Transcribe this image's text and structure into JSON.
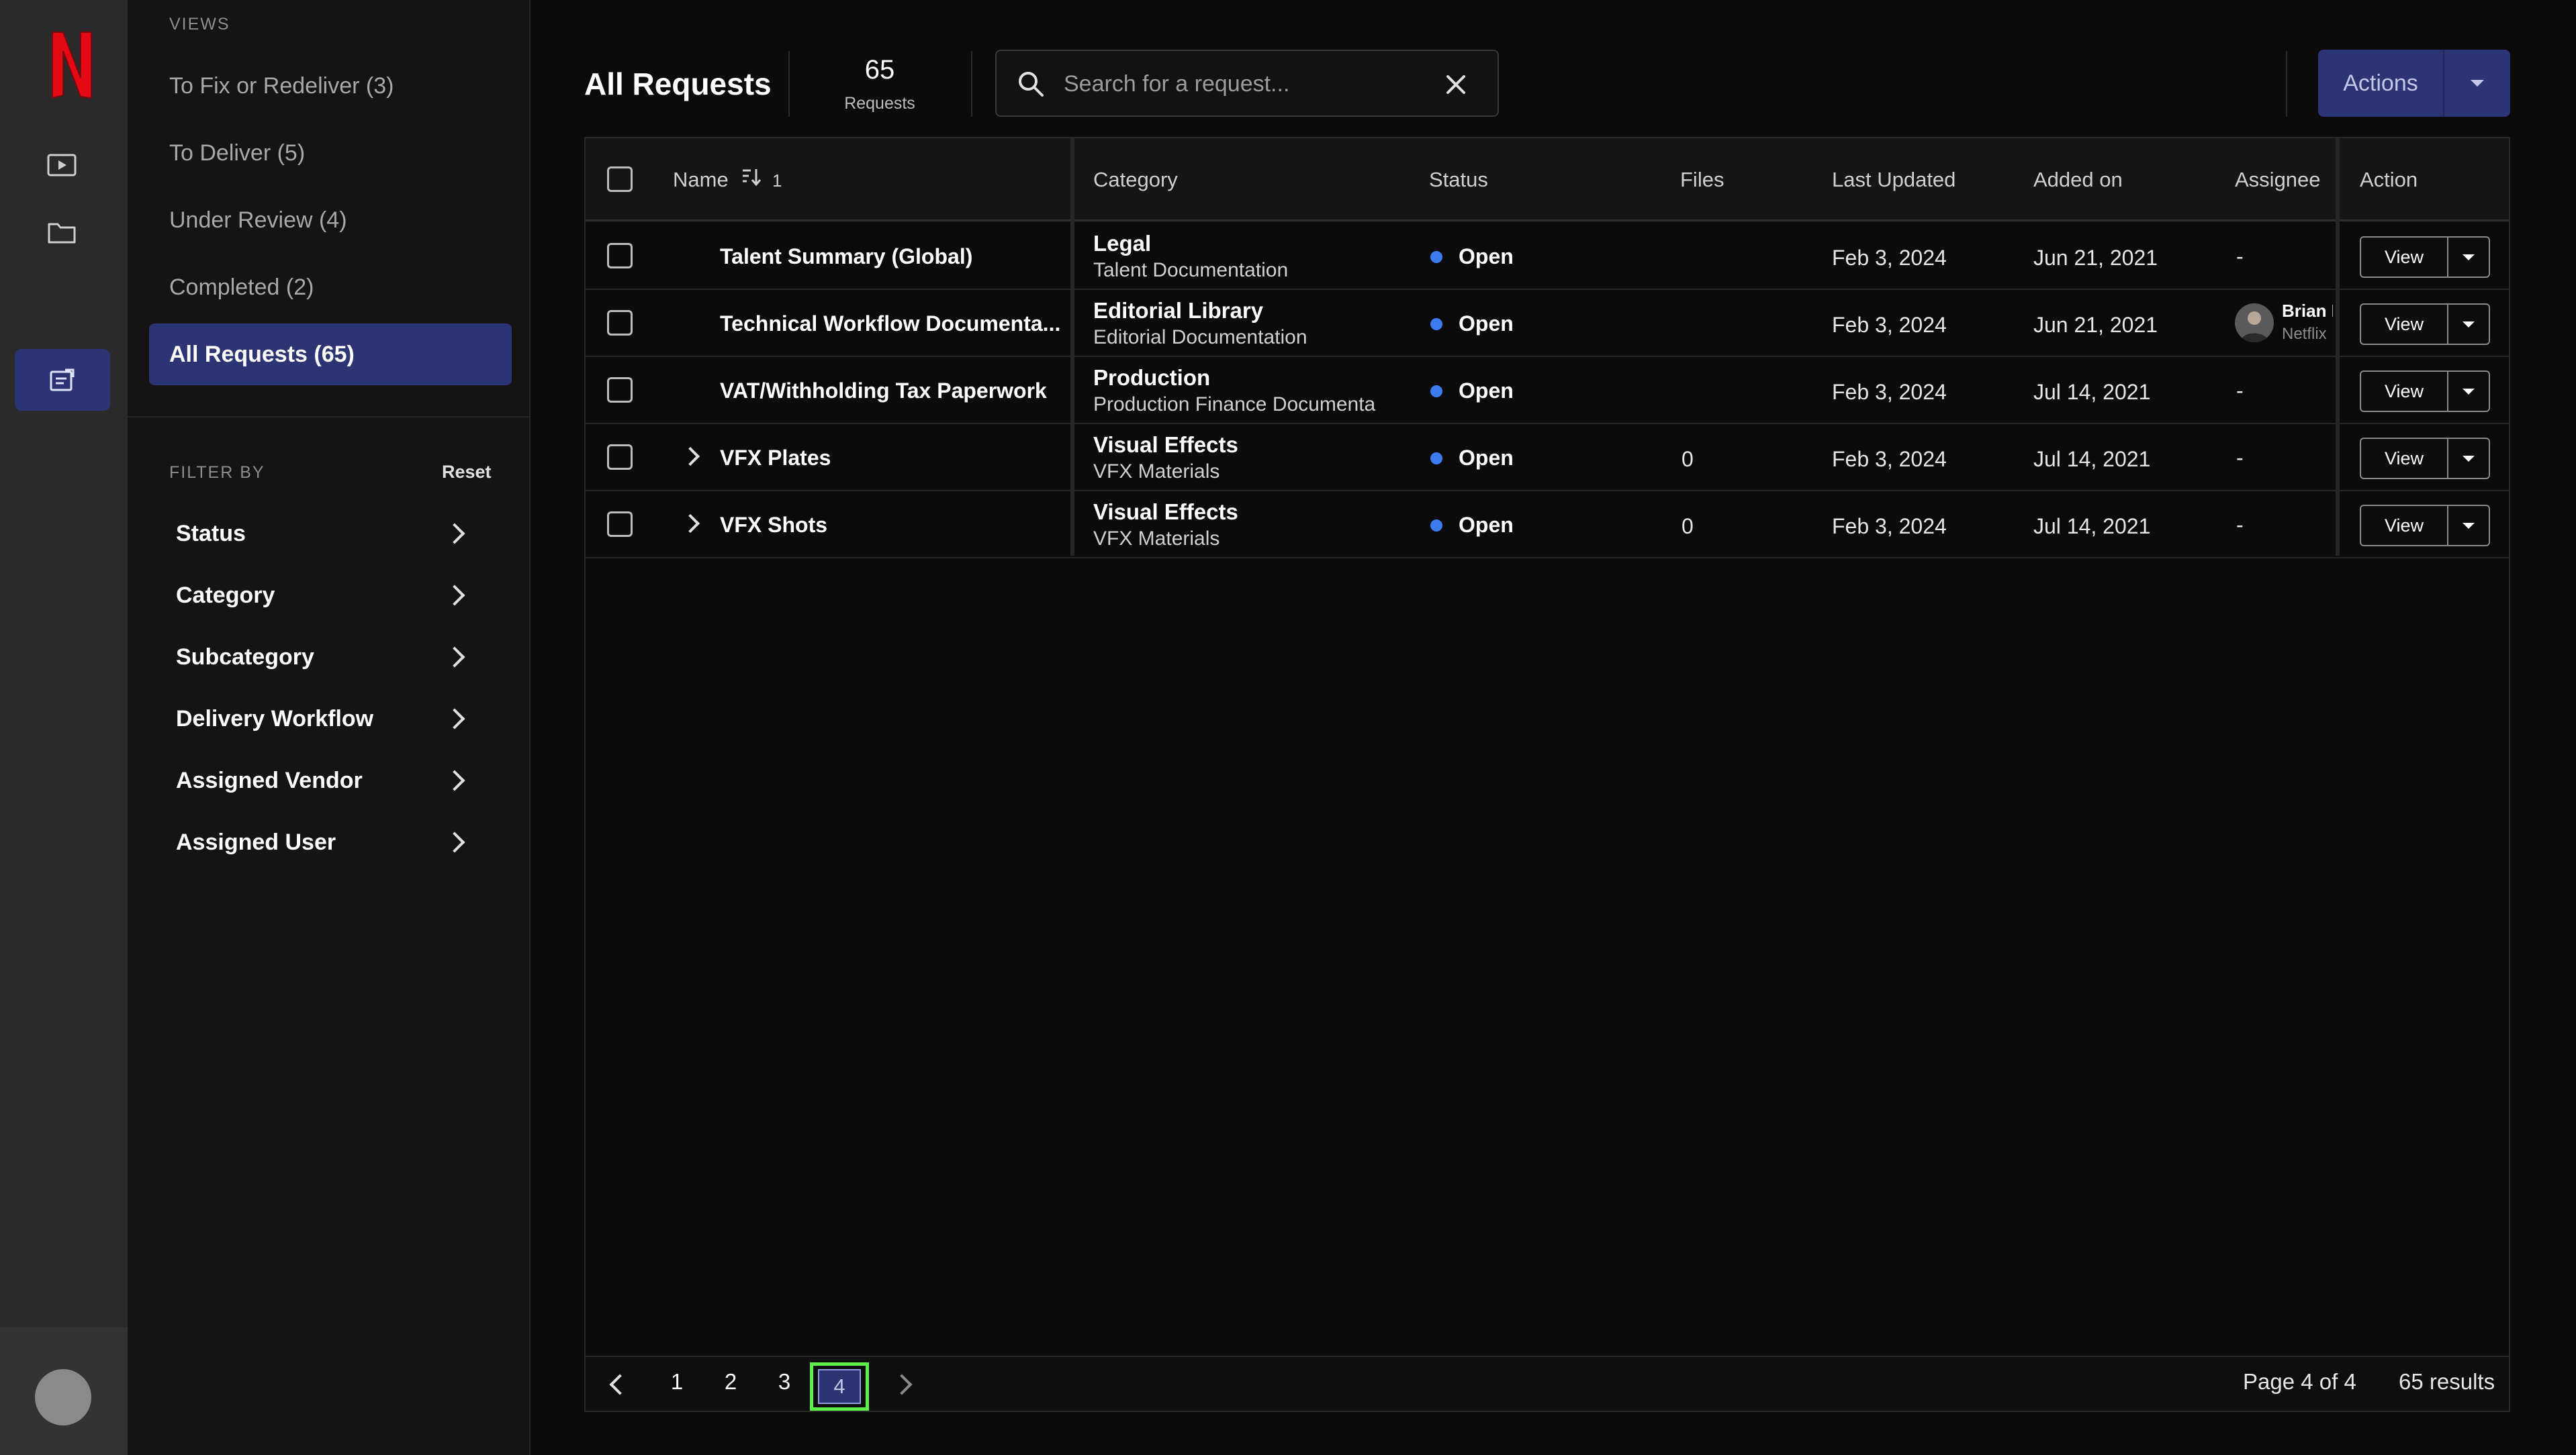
{
  "sidebar": {
    "views_label": "VIEWS",
    "views": [
      {
        "label": "To Fix or Redeliver (3)"
      },
      {
        "label": "To Deliver (5)"
      },
      {
        "label": "Under Review (4)"
      },
      {
        "label": "Completed (2)"
      },
      {
        "label": "All Requests (65)"
      }
    ],
    "filter_label": "FILTER BY",
    "reset_label": "Reset",
    "filters": [
      {
        "label": "Status"
      },
      {
        "label": "Category"
      },
      {
        "label": "Subcategory"
      },
      {
        "label": "Delivery Workflow"
      },
      {
        "label": "Assigned Vendor"
      },
      {
        "label": "Assigned User"
      }
    ]
  },
  "header": {
    "title": "All Requests",
    "count": "65",
    "count_label": "Requests",
    "search_placeholder": "Search for a request...",
    "actions_label": "Actions"
  },
  "table": {
    "columns": {
      "name": "Name",
      "sort_indicator": "1",
      "category": "Category",
      "status": "Status",
      "files": "Files",
      "last_updated": "Last Updated",
      "added_on": "Added on",
      "assignee": "Assignee",
      "action": "Action"
    },
    "rows": [
      {
        "name": "Talent Summary (Global)",
        "category": "Legal",
        "subcategory": "Talent Documentation",
        "status": "Open",
        "files": "",
        "last_updated": "Feb 3, 2024",
        "added_on": "Jun 21, 2021",
        "assignee": "-",
        "view": "View"
      },
      {
        "name": "Technical Workflow Documenta...",
        "category": "Editorial Library",
        "subcategory": "Editorial Documentation",
        "status": "Open",
        "files": "",
        "last_updated": "Feb 3, 2024",
        "added_on": "Jun 21, 2021",
        "assignee_name": "Brian I",
        "assignee_org": "Netflix",
        "view": "View"
      },
      {
        "name": "VAT/Withholding Tax Paperwork",
        "category": "Production",
        "subcategory": "Production Finance Documenta",
        "status": "Open",
        "files": "",
        "last_updated": "Feb 3, 2024",
        "added_on": "Jul 14, 2021",
        "assignee": "-",
        "view": "View"
      },
      {
        "name": "VFX Plates",
        "category": "Visual Effects",
        "subcategory": "VFX Materials",
        "status": "Open",
        "files": "0",
        "last_updated": "Feb 3, 2024",
        "added_on": "Jul 14, 2021",
        "assignee": "-",
        "view": "View"
      },
      {
        "name": "VFX Shots",
        "category": "Visual Effects",
        "subcategory": "VFX Materials",
        "status": "Open",
        "files": "0",
        "last_updated": "Feb 3, 2024",
        "added_on": "Jul 14, 2021",
        "assignee": "-",
        "view": "View"
      }
    ]
  },
  "pagination": {
    "pages": [
      "1",
      "2",
      "3",
      "4"
    ],
    "current": "4",
    "page_info": "Page 4 of 4",
    "results": "65 results"
  },
  "colors": {
    "accent": "#2c3473",
    "status_open": "#3d7bf0",
    "brand": "#e50914",
    "highlight": "#5ef04a"
  }
}
